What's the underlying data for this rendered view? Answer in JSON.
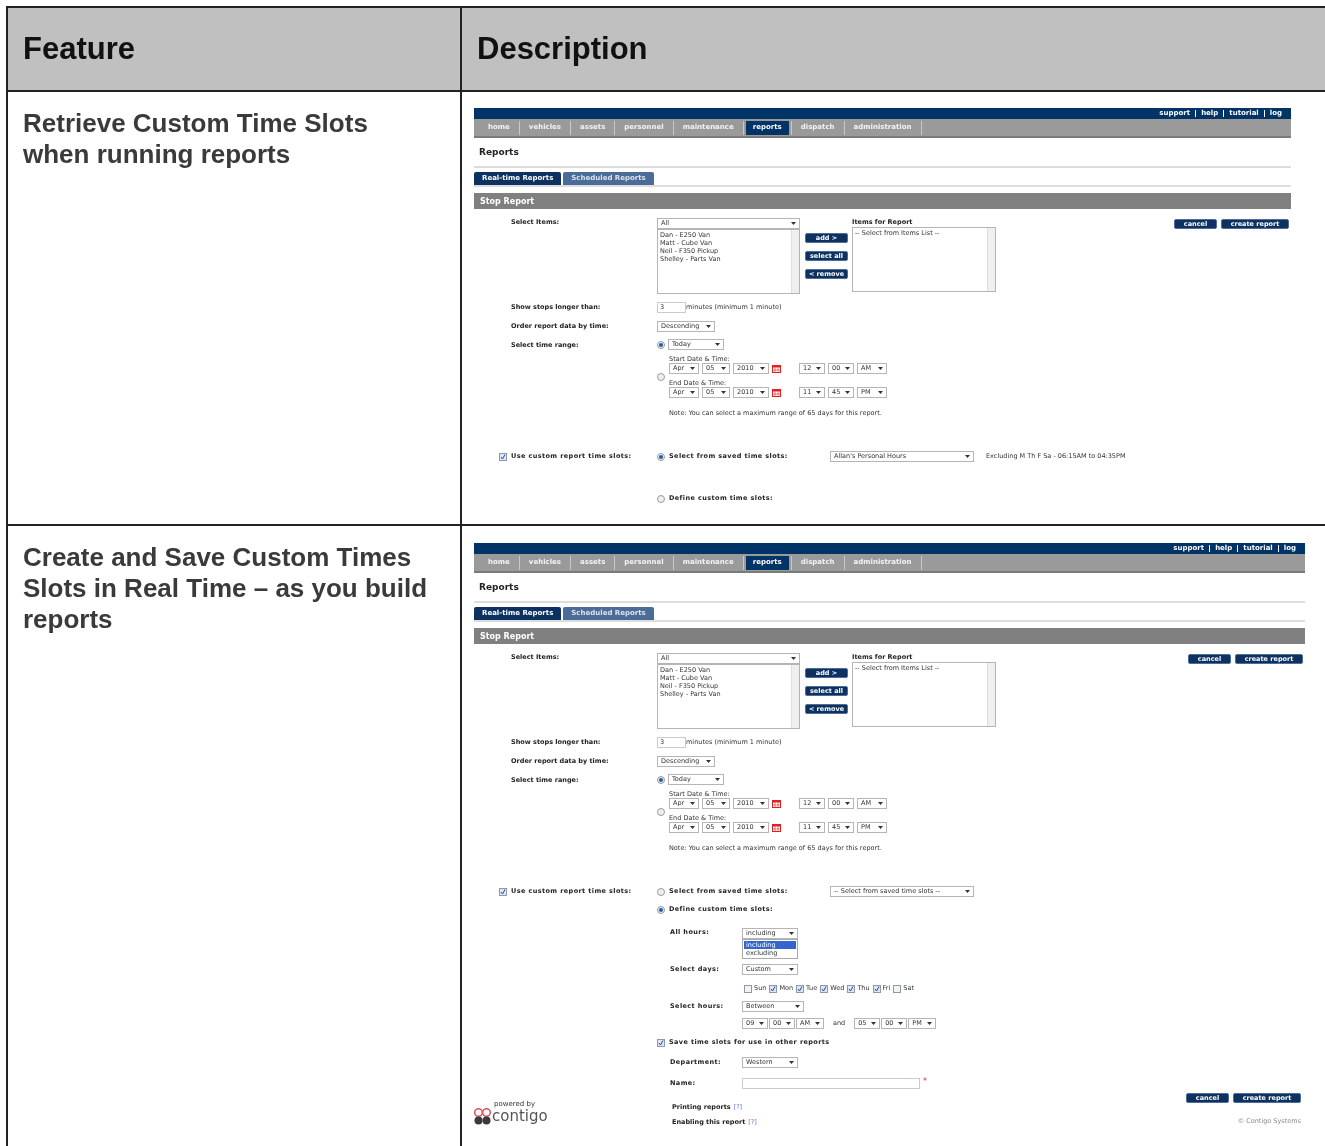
{
  "table": {
    "columns": [
      "Feature",
      "Description"
    ],
    "rows": [
      {
        "feature": "Retrieve Custom Time Slots when running reports",
        "screen": {
          "top_links": [
            "support",
            "help",
            "tutorial",
            "log"
          ],
          "nav": [
            {
              "label": "home",
              "selected": false
            },
            {
              "label": "vehicles",
              "selected": false
            },
            {
              "label": "assets",
              "selected": false
            },
            {
              "label": "personnel",
              "selected": false
            },
            {
              "label": "maintenance",
              "selected": false
            },
            {
              "label": "reports",
              "selected": true
            },
            {
              "label": "dispatch",
              "selected": false
            },
            {
              "label": "administration",
              "selected": false
            }
          ],
          "page_title": "Reports",
          "tabs": [
            {
              "label": "Real-time Reports",
              "selected": true
            },
            {
              "label": "Scheduled Reports",
              "selected": false
            }
          ],
          "section_title": "Stop Report",
          "select_items": {
            "label": "Select Items:",
            "filter": "All",
            "items": [
              "Dan - E250 Van",
              "Matt - Cube Van",
              "Neil - F350 Pickup",
              "Shelley - Parts Van"
            ]
          },
          "move_buttons": [
            "add >",
            "select all",
            "< remove"
          ],
          "items_for_report": {
            "label": "Items for Report",
            "items": [
              "-- Select from Items List --"
            ]
          },
          "actions": [
            "cancel",
            "create report"
          ],
          "stops": {
            "label": "Show stops longer than:",
            "value": "3",
            "unit": "minutes (minimum 1 minute)"
          },
          "order": {
            "label": "Order report data by time:",
            "value": "Descending"
          },
          "time_range": {
            "label": "Select time range:",
            "preset": {
              "selected": true,
              "value": "Today"
            },
            "custom": {
              "selected": false,
              "start_label": "Start Date & Time:",
              "start": [
                "Apr",
                "05",
                "2010"
              ],
              "start_time": [
                "12",
                "00",
                "AM"
              ],
              "end_label": "End Date & Time:",
              "end": [
                "Apr",
                "05",
                "2010"
              ],
              "end_time": [
                "11",
                "45",
                "PM"
              ]
            },
            "note": "Note: You can select a maximum range of 65 days for this report."
          },
          "custom_slots": {
            "checked": true,
            "label": "Use custom report time slots:",
            "saved": {
              "selected": true,
              "label": "Select from saved time slots:",
              "value": "Allan's Personal Hours",
              "summary": "Excluding M Th F Sa - 06:15AM to 04:35PM"
            },
            "define": {
              "selected": false,
              "label": "Define custom time slots:"
            }
          }
        }
      },
      {
        "feature": "Create and Save Custom Times Slots in Real Time – as you build reports",
        "screen": {
          "top_links": [
            "support",
            "help",
            "tutorial",
            "log"
          ],
          "nav": [
            {
              "label": "home",
              "selected": false
            },
            {
              "label": "vehicles",
              "selected": false
            },
            {
              "label": "assets",
              "selected": false
            },
            {
              "label": "personnel",
              "selected": false
            },
            {
              "label": "maintenance",
              "selected": false
            },
            {
              "label": "reports",
              "selected": true
            },
            {
              "label": "dispatch",
              "selected": false
            },
            {
              "label": "administration",
              "selected": false
            }
          ],
          "page_title": "Reports",
          "tabs": [
            {
              "label": "Real-time Reports",
              "selected": true
            },
            {
              "label": "Scheduled Reports",
              "selected": false
            }
          ],
          "section_title": "Stop Report",
          "select_items": {
            "label": "Select Items:",
            "filter": "All",
            "items": [
              "Dan - E250 Van",
              "Matt - Cube Van",
              "Neil - F350 Pickup",
              "Shelley - Parts Van"
            ]
          },
          "move_buttons": [
            "add >",
            "select all",
            "< remove"
          ],
          "items_for_report": {
            "label": "Items for Report",
            "items": [
              "-- Select from Items List --"
            ]
          },
          "actions": [
            "cancel",
            "create report"
          ],
          "stops": {
            "label": "Show stops longer than:",
            "value": "3",
            "unit": "minutes (minimum 1 minute)"
          },
          "order": {
            "label": "Order report data by time:",
            "value": "Descending"
          },
          "time_range": {
            "label": "Select time range:",
            "preset": {
              "selected": true,
              "value": "Today"
            },
            "custom": {
              "selected": false,
              "start_label": "Start Date & Time:",
              "start": [
                "Apr",
                "05",
                "2010"
              ],
              "start_time": [
                "12",
                "00",
                "AM"
              ],
              "end_label": "End Date & Time:",
              "end": [
                "Apr",
                "05",
                "2010"
              ],
              "end_time": [
                "11",
                "45",
                "PM"
              ]
            },
            "note": "Note: You can select a maximum range of 65 days for this report."
          },
          "custom_slots": {
            "checked": true,
            "label": "Use custom report time slots:",
            "saved": {
              "selected": false,
              "label": "Select from saved time slots:",
              "value": "-- Select from saved time slots --"
            },
            "define": {
              "selected": true,
              "label": "Define custom time slots:",
              "all_hours": {
                "label": "All hours:",
                "value": "including",
                "options": [
                  {
                    "label": "including",
                    "selected": true
                  },
                  {
                    "label": "excluding",
                    "selected": false
                  }
                ]
              },
              "days": {
                "label": "Select days:",
                "value": "Custom",
                "options": [
                  {
                    "label": "Sun",
                    "checked": false
                  },
                  {
                    "label": "Mon",
                    "checked": true
                  },
                  {
                    "label": "Tue",
                    "checked": true
                  },
                  {
                    "label": "Wed",
                    "checked": true
                  },
                  {
                    "label": "Thu",
                    "checked": true
                  },
                  {
                    "label": "Fri",
                    "checked": true
                  },
                  {
                    "label": "Sat",
                    "checked": false
                  }
                ]
              },
              "hours": {
                "label": "Select hours:",
                "value": "Between",
                "from": [
                  "09",
                  "00",
                  "AM"
                ],
                "joiner": "and",
                "to": [
                  "05",
                  "00",
                  "PM"
                ]
              },
              "save": {
                "checked": true,
                "label": "Save time slots for use in other reports"
              },
              "department": {
                "label": "Department:",
                "value": "Western"
              },
              "name": {
                "label": "Name:",
                "required": "*"
              }
            }
          },
          "help_links": [
            {
              "label": "Printing reports",
              "help": "[?]"
            },
            {
              "label": "Enabling this report",
              "help": "[?]"
            }
          ],
          "bottom_actions": [
            "cancel",
            "create report"
          ],
          "logo": {
            "caption": "powered by",
            "name": "contigo"
          },
          "footer": "© Contigo Systems"
        }
      }
    ]
  }
}
